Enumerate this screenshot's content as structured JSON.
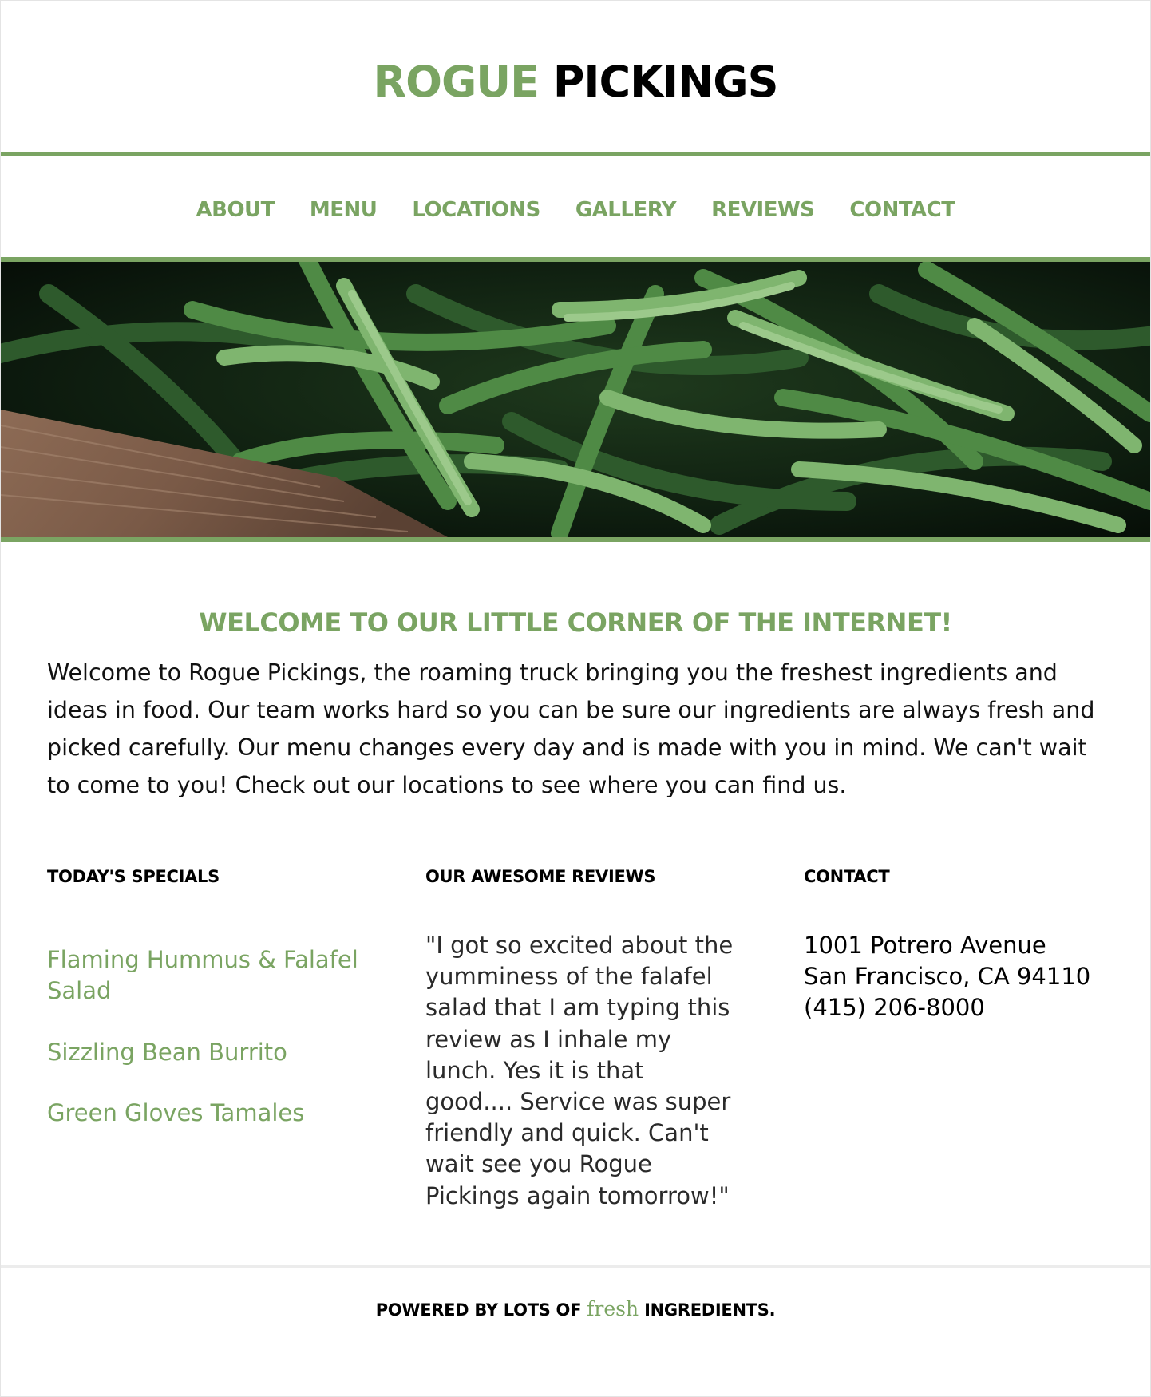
{
  "header": {
    "logo_part1": "ROGUE",
    "logo_part2": "PICKINGS"
  },
  "nav": {
    "items": [
      {
        "label": "ABOUT"
      },
      {
        "label": "MENU"
      },
      {
        "label": "LOCATIONS"
      },
      {
        "label": "GALLERY"
      },
      {
        "label": "REVIEWS"
      },
      {
        "label": "CONTACT"
      }
    ]
  },
  "welcome": {
    "heading": "WELCOME TO OUR LITTLE CORNER OF THE INTERNET!",
    "body": "Welcome to Rogue Pickings, the roaming truck bringing you the freshest ingredients and ideas in food. Our team works hard so you can be sure our ingredients are always fresh and picked carefully. Our menu changes every day and is made with you in mind. We can't wait to come to you! Check out our locations to see where you can find us."
  },
  "specials": {
    "title": "TODAY'S SPECIALS",
    "items": [
      {
        "label": "Flaming Hummus & Falafel Salad"
      },
      {
        "label": "Sizzling Bean Burrito"
      },
      {
        "label": "Green Gloves Tamales"
      }
    ]
  },
  "reviews": {
    "title": "OUR AWESOME REVIEWS",
    "quote": "\"I got so excited about the yumminess of the falafel salad that I am typing this review as I inhale my lunch. Yes it is that good.... Service was super friendly and quick. Can't wait see you Rogue Pickings again tomorrow!\""
  },
  "contact": {
    "title": "CONTACT",
    "address_line1": "1001 Potrero Avenue",
    "address_line2": "San Francisco, CA 94110",
    "phone": "(415) 206-8000"
  },
  "footer": {
    "prefix": "POWERED BY LOTS OF",
    "highlight": "fresh",
    "suffix": "INGREDIENTS."
  },
  "colors": {
    "accent_green": "#7aa462",
    "text": "#000000",
    "background": "#ffffff"
  }
}
